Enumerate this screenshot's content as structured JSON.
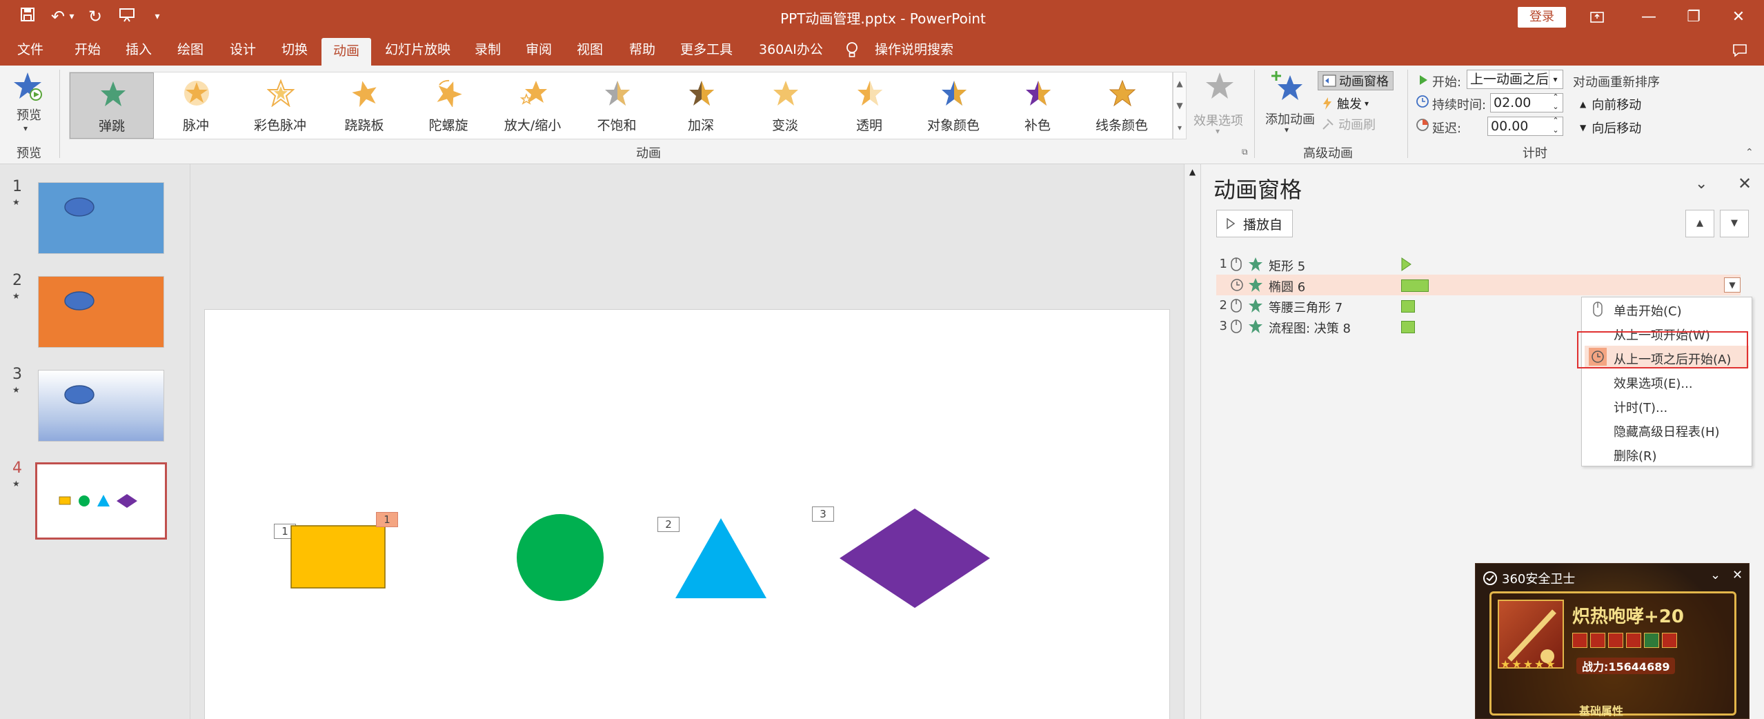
{
  "window": {
    "title": "PPT动画管理.pptx  -  PowerPoint",
    "login_label": "登录",
    "qat_icons": [
      "save-icon",
      "undo-icon",
      "dropdown-icon",
      "redo-icon",
      "present-icon",
      "customize-icon"
    ]
  },
  "menu": {
    "items": [
      "文件",
      "开始",
      "插入",
      "绘图",
      "设计",
      "切换",
      "动画",
      "幻灯片放映",
      "录制",
      "审阅",
      "视图",
      "帮助",
      "更多工具",
      "360AI办公"
    ],
    "active": "动画",
    "search_label": "操作说明搜索"
  },
  "ribbon": {
    "preview": {
      "label": "预览",
      "group_label": "预览"
    },
    "effects": [
      "弹跳",
      "脉冲",
      "彩色脉冲",
      "跷跷板",
      "陀螺旋",
      "放大/缩小",
      "不饱和",
      "加深",
      "变淡",
      "透明",
      "对象颜色",
      "补色",
      "线条颜色"
    ],
    "selected_effect": "弹跳",
    "effects_group_label": "动画",
    "effect_options_label": "效果选项",
    "add_animation_label": "添加动画",
    "anim_pane_label": "动画窗格",
    "trigger_label": "触发",
    "anim_painter_label": "动画刷",
    "advanced_group_label": "高级动画",
    "start_label": "开始:",
    "start_value": "上一动画之后",
    "duration_label": "持续时间:",
    "duration_value": "02.00",
    "delay_label": "延迟:",
    "delay_value": "00.00",
    "timing_group_label": "计时",
    "reorder_label": "对动画重新排序",
    "move_earlier_label": "向前移动",
    "move_later_label": "向后移动"
  },
  "slides": [
    {
      "number": "1",
      "bg": "#5b9bd5"
    },
    {
      "number": "2",
      "bg": "#ed7d31"
    },
    {
      "number": "3",
      "bg": "#b4c7e7"
    },
    {
      "number": "4",
      "bg": "#ffffff"
    }
  ],
  "current_slide": "4",
  "slide_tags": [
    "1",
    "1",
    "2",
    "3"
  ],
  "anim_pane": {
    "title": "动画窗格",
    "play_from_label": "播放自",
    "rows": [
      {
        "num": "1",
        "name": "矩形 5"
      },
      {
        "num": "",
        "name": "椭圆 6"
      },
      {
        "num": "2",
        "name": "等腰三角形 7"
      },
      {
        "num": "3",
        "name": "流程图: 决策 8"
      }
    ]
  },
  "context_menu": {
    "items": [
      "单击开始(C)",
      "从上一项开始(W)",
      "从上一项之后开始(A)",
      "效果选项(E)...",
      "计时(T)...",
      "隐藏高级日程表(H)",
      "删除(R)"
    ],
    "highlighted": "从上一项之后开始(A)"
  },
  "popup": {
    "brand": "360安全卫士",
    "headline": "炽热咆哮+20",
    "power": "战力:15644689",
    "footer": "基础属性"
  },
  "colors": {
    "accent": "#b7472a",
    "rect": "#ffc000",
    "circle": "#00b050",
    "triangle": "#00b0f0",
    "diamond": "#7030a0",
    "oval": "#4472c4",
    "timebar": "#92d050",
    "highlight_row": "#fbe1d6",
    "annotation_box": "#e03030"
  }
}
